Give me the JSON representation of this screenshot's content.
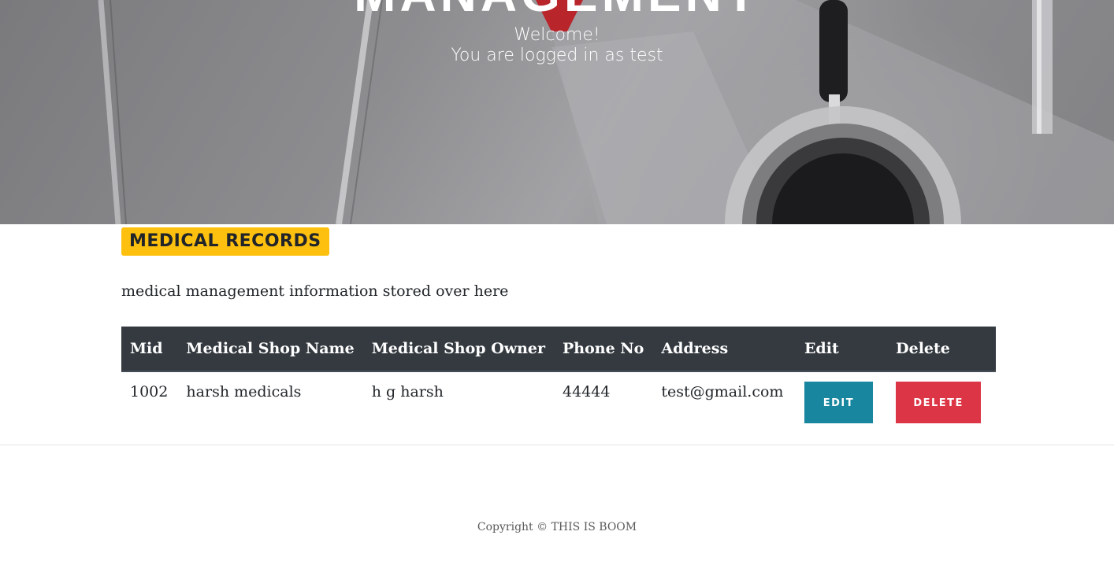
{
  "hero": {
    "title": "MANAGEMENT",
    "welcome": "Welcome!",
    "logged_in": "You are logged in as test"
  },
  "section": {
    "badge": "MEDICAL RECORDS",
    "description": "medical management information stored over here"
  },
  "table": {
    "headers": [
      "Mid",
      "Medical Shop Name",
      "Medical Shop Owner",
      "Phone No",
      "Address",
      "Edit",
      "Delete"
    ],
    "rows": [
      {
        "mid": "1002",
        "shop_name": "harsh medicals",
        "owner": "h g harsh",
        "phone": "44444",
        "address": "test@gmail.com",
        "edit_label": "EDIT",
        "delete_label": "DELETE"
      }
    ]
  },
  "footer": {
    "copyright": "Copyright © THIS IS BOOM"
  },
  "colors": {
    "badge": "#fec00f",
    "table_header": "#343a40",
    "edit_button": "#17869e",
    "delete_button": "#dc3545"
  }
}
